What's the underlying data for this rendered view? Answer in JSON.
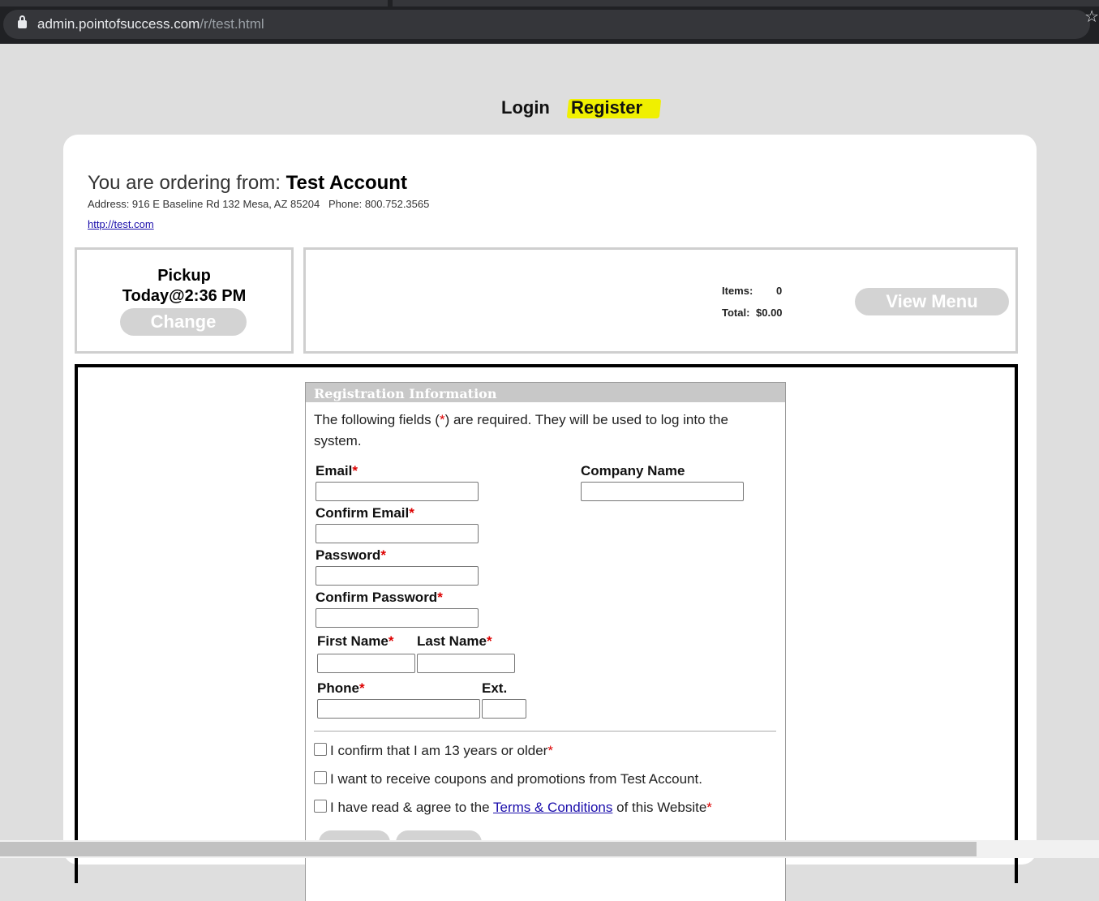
{
  "browser": {
    "url_host": "admin.pointofsuccess.com",
    "url_path": "/r/test.html"
  },
  "nav": {
    "login": "Login",
    "register": "Register",
    "highlight_color": "#f0f000"
  },
  "store": {
    "ordering_prefix": "You are ordering from:",
    "name": "Test Account",
    "address": "Address: 916 E Baseline Rd 132 Mesa, AZ 85204   Phone: 800.752.3565",
    "website": "http://test.com"
  },
  "pickup": {
    "label": "Pickup",
    "time": "Today@2:36 PM",
    "change_label": "Change"
  },
  "cart": {
    "items_label": "Items:",
    "items_value": "0",
    "total_label": "Total:",
    "total_value": "$0.00",
    "view_menu_label": "View Menu"
  },
  "registration": {
    "header": "Registration Information",
    "intro_before": "The following fields (",
    "intro_star": "*",
    "intro_after": ") are required. They will be used to log into the system.",
    "fields": {
      "email": "Email",
      "confirm_email": "Confirm Email",
      "password": "Password",
      "confirm_password": "Confirm Password",
      "first_name": "First Name",
      "last_name": "Last Name",
      "phone": "Phone",
      "ext": "Ext.",
      "company_name": "Company Name"
    },
    "required_mark": "*",
    "checkboxes": {
      "age": "I confirm that I am 13 years or older",
      "promotions": "I want to receive coupons and promotions from Test Account.",
      "terms_before": "I have read & agree to the ",
      "terms_link": "Terms & Conditions",
      "terms_after": " of this Website"
    }
  },
  "colors": {
    "page_bg": "#dedede",
    "button_gray": "#d3d3d3",
    "required_red": "#dd0000",
    "link_blue": "#1a0dab"
  }
}
